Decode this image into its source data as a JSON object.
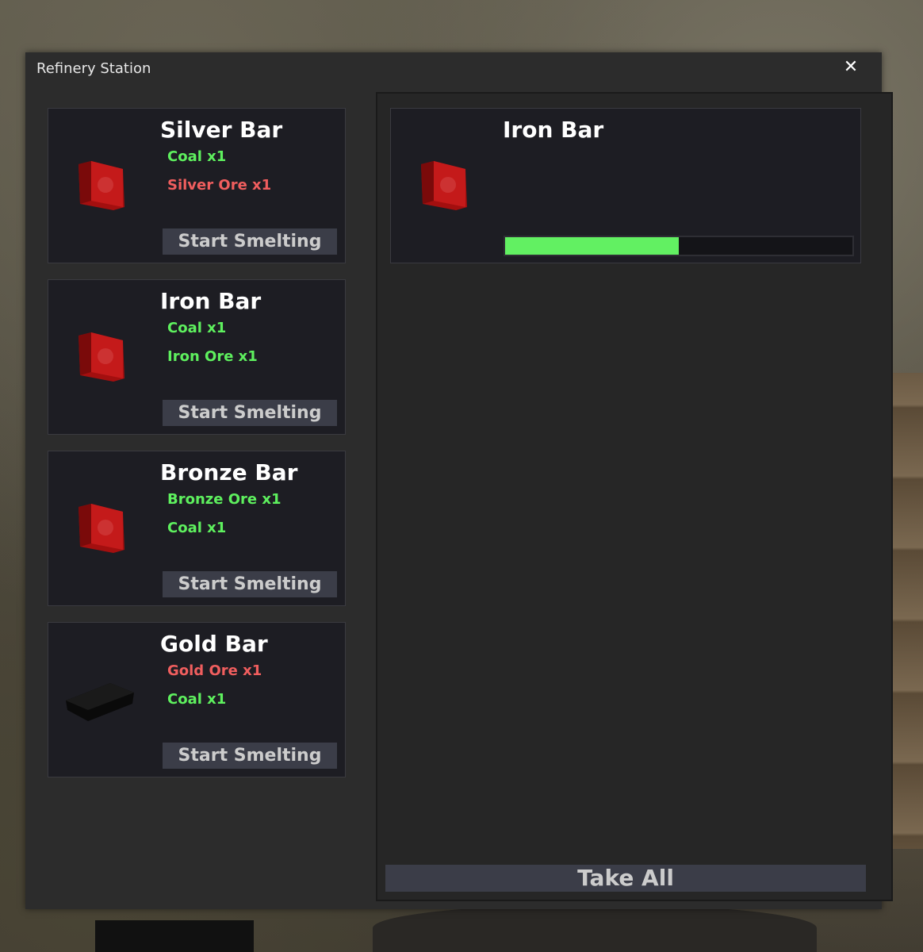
{
  "window": {
    "title": "Refinery Station",
    "close_label": "✕"
  },
  "recipes": [
    {
      "name": "Silver Bar",
      "icon": "red-bar-icon",
      "ingredients": [
        {
          "label": "Coal x1",
          "available": true
        },
        {
          "label": "Silver Ore x1",
          "available": false
        }
      ],
      "button_label": "Start Smelting"
    },
    {
      "name": "Iron Bar",
      "icon": "red-bar-icon",
      "ingredients": [
        {
          "label": "Coal x1",
          "available": true
        },
        {
          "label": "Iron Ore x1",
          "available": true
        }
      ],
      "button_label": "Start Smelting"
    },
    {
      "name": "Bronze Bar",
      "icon": "red-bar-icon",
      "ingredients": [
        {
          "label": "Bronze Ore x1",
          "available": true
        },
        {
          "label": "Coal x1",
          "available": true
        }
      ],
      "button_label": "Start Smelting"
    },
    {
      "name": "Gold Bar",
      "icon": "black-bar-icon",
      "ingredients": [
        {
          "label": "Gold Ore x1",
          "available": false
        },
        {
          "label": "Coal x1",
          "available": true
        }
      ],
      "button_label": "Start Smelting"
    }
  ],
  "output": {
    "slot": {
      "name": "Iron Bar",
      "icon": "red-bar-icon",
      "progress": 0.5
    },
    "take_all_label": "Take All"
  },
  "colors": {
    "available": "#5ef05e",
    "missing": "#f05e5e",
    "progress": "#62f062"
  }
}
